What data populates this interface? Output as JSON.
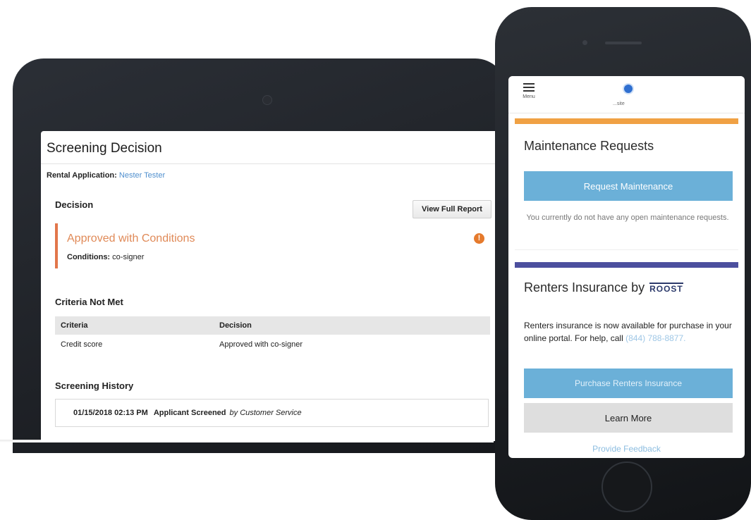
{
  "tablet": {
    "page_title": "Screening Decision",
    "rental_label": "Rental Application:",
    "applicant_name": "Nester Tester",
    "decision_heading": "Decision",
    "view_report_label": "View Full Report",
    "decision_status": "Approved with Conditions",
    "conditions_label": "Conditions:",
    "conditions_value": "co-signer",
    "warning_glyph": "!",
    "criteria_heading": "Criteria Not Met",
    "criteria_columns": [
      "Criteria",
      "Decision"
    ],
    "criteria_rows": [
      [
        "Credit score",
        "Approved with co-signer"
      ]
    ],
    "history_heading": "Screening History",
    "history_entries": [
      {
        "timestamp": "01/15/2018 02:13 PM",
        "action": "Applicant Screened",
        "by": "by Customer Service"
      }
    ]
  },
  "phone": {
    "menu_label": "Menu",
    "logo_text": "...site",
    "maintenance_title": "Maintenance Requests",
    "request_button": "Request Maintenance",
    "maintenance_note": "You currently do not have any open maintenance requests.",
    "insurance_title": "Renters Insurance by",
    "insurance_brand": "ROOST",
    "insurance_desc": "Renters insurance is now available for purchase in your online portal. For help, call",
    "insurance_phone": "(844) 788-8877.",
    "purchase_button": "Purchase Renters Insurance",
    "learn_button": "Learn More",
    "feedback_link": "Provide Feedback"
  },
  "colors": {
    "accent_blue": "#6bb0d8",
    "status_orange": "#e2764b",
    "maintenance_bar": "#f0a144",
    "insurance_bar": "#4c4f9e"
  }
}
